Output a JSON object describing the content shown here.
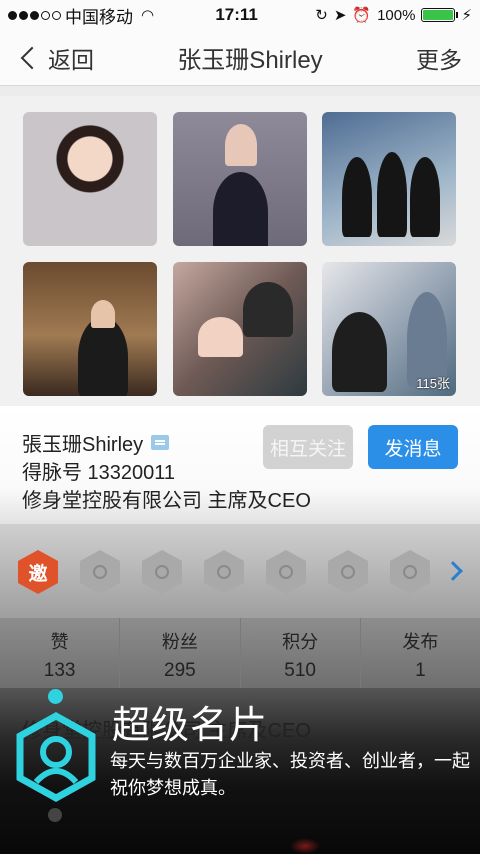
{
  "status_bar": {
    "carrier": "中国移动",
    "time": "17:11",
    "battery": "100%"
  },
  "nav": {
    "back_label": "返回",
    "title": "张玉珊Shirley",
    "more_label": "更多"
  },
  "photos": {
    "count_badge": "115张"
  },
  "profile": {
    "name": "張玉珊Shirley",
    "id_line": "得脉号 13320011",
    "company": "修身堂控股有限公司 主席及CEO",
    "follow_button": "相互关注",
    "message_button": "发消息"
  },
  "badges": {
    "invite_label": "邀"
  },
  "stats": [
    {
      "label": "赞",
      "value": "133"
    },
    {
      "label": "粉丝",
      "value": "295"
    },
    {
      "label": "积分",
      "value": "510"
    },
    {
      "label": "发布",
      "value": "1"
    }
  ],
  "ghost_text": "修身堂控股有限公司 主席及CEO",
  "overlay": {
    "title": "超级名片",
    "description": "每天与数百万企业家、投资者、创业者，一起祝你梦想成真。"
  },
  "colors": {
    "accent_blue": "#2b8fe8",
    "logo_cyan": "#2fd3e0",
    "invite_badge": "#e0522a"
  }
}
